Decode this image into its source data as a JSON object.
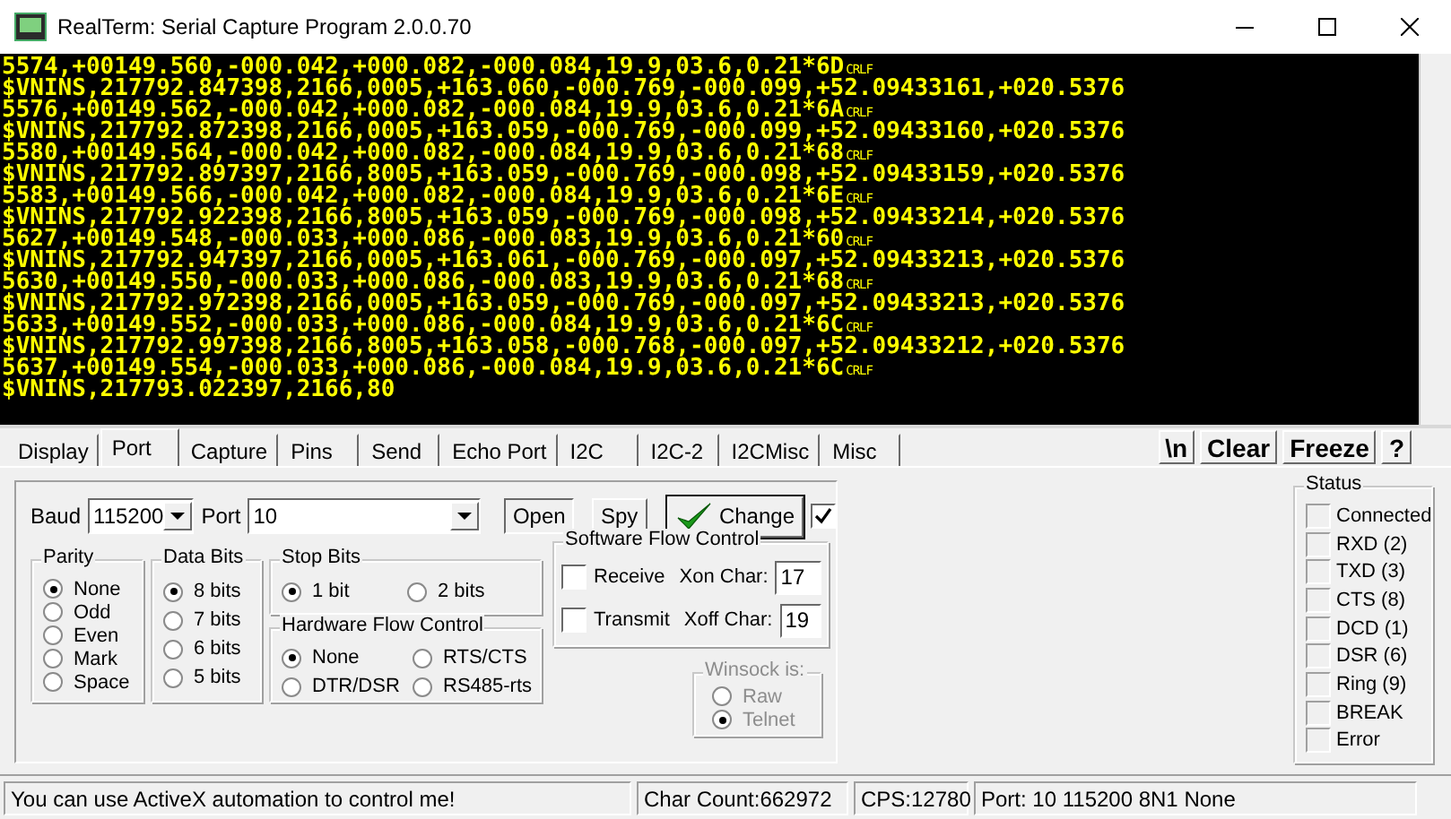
{
  "window": {
    "title": "RealTerm: Serial Capture Program 2.0.0.70"
  },
  "terminal": {
    "lines": [
      {
        "text": "5574,+00149.560,-000.042,+000.082,-000.084,19.9,03.6,0.21*6D",
        "eol": "CRLF"
      },
      {
        "text": "$VNINS,217792.847398,2166,0005,+163.060,-000.769,-000.099,+52.09433161,+020.5376"
      },
      {
        "text": "5576,+00149.562,-000.042,+000.082,-000.084,19.9,03.6,0.21*6A",
        "eol": "CRLF"
      },
      {
        "text": "$VNINS,217792.872398,2166,0005,+163.059,-000.769,-000.099,+52.09433160,+020.5376"
      },
      {
        "text": "5580,+00149.564,-000.042,+000.082,-000.084,19.9,03.6,0.21*68",
        "eol": "CRLF"
      },
      {
        "text": "$VNINS,217792.897397,2166,8005,+163.059,-000.769,-000.098,+52.09433159,+020.5376"
      },
      {
        "text": "5583,+00149.566,-000.042,+000.082,-000.084,19.9,03.6,0.21*6E",
        "eol": "CRLF"
      },
      {
        "text": "$VNINS,217792.922398,2166,8005,+163.059,-000.769,-000.098,+52.09433214,+020.5376"
      },
      {
        "text": "5627,+00149.548,-000.033,+000.086,-000.083,19.9,03.6,0.21*60",
        "eol": "CRLF"
      },
      {
        "text": "$VNINS,217792.947397,2166,0005,+163.061,-000.769,-000.097,+52.09433213,+020.5376"
      },
      {
        "text": "5630,+00149.550,-000.033,+000.086,-000.083,19.9,03.6,0.21*68",
        "eol": "CRLF"
      },
      {
        "text": "$VNINS,217792.972398,2166,0005,+163.059,-000.769,-000.097,+52.09433213,+020.5376"
      },
      {
        "text": "5633,+00149.552,-000.033,+000.086,-000.084,19.9,03.6,0.21*6C",
        "eol": "CRLF"
      },
      {
        "text": "$VNINS,217792.997398,2166,8005,+163.058,-000.768,-000.097,+52.09433212,+020.5376"
      },
      {
        "text": "5637,+00149.554,-000.033,+000.086,-000.084,19.9,03.6,0.21*6C",
        "eol": "CRLF"
      },
      {
        "text": "$VNINS,217793.022397,2166,80"
      }
    ]
  },
  "tabs": [
    {
      "label": "Display",
      "selected": false
    },
    {
      "label": "Port",
      "selected": true
    },
    {
      "label": "Capture",
      "selected": false
    },
    {
      "label": "Pins",
      "selected": false
    },
    {
      "label": "Send",
      "selected": false
    },
    {
      "label": "Echo Port",
      "selected": false
    },
    {
      "label": "I2C",
      "selected": false
    },
    {
      "label": "I2C-2",
      "selected": false
    },
    {
      "label": "I2CMisc",
      "selected": false
    },
    {
      "label": "Misc",
      "selected": false
    }
  ],
  "toolbar_buttons": [
    {
      "label": "\\n"
    },
    {
      "label": "Clear"
    },
    {
      "label": "Freeze"
    },
    {
      "label": "?"
    }
  ],
  "port": {
    "baud": {
      "label": "Baud",
      "value": "115200"
    },
    "port": {
      "label": "Port",
      "value": "10"
    },
    "open_button": {
      "label": "Open",
      "pressed": true
    },
    "spy_button": {
      "label": "Spy",
      "pressed": false
    },
    "change_button": {
      "label": "Change"
    },
    "auto_checkbox": {
      "checked": true
    },
    "parity": {
      "title": "Parity",
      "options": [
        {
          "label": "None",
          "selected": true
        },
        {
          "label": "Odd",
          "selected": false
        },
        {
          "label": "Even",
          "selected": false
        },
        {
          "label": "Mark",
          "selected": false
        },
        {
          "label": "Space",
          "selected": false
        }
      ]
    },
    "data_bits": {
      "title": "Data Bits",
      "options": [
        {
          "label": "8 bits",
          "selected": true
        },
        {
          "label": "7 bits",
          "selected": false
        },
        {
          "label": "6 bits",
          "selected": false
        },
        {
          "label": "5 bits",
          "selected": false
        }
      ]
    },
    "stop_bits": {
      "title": "Stop Bits",
      "options": [
        {
          "label": "1 bit",
          "selected": true
        },
        {
          "label": "2 bits",
          "selected": false
        }
      ]
    },
    "hardware_flow": {
      "title": "Hardware Flow Control",
      "options": [
        {
          "label": "None",
          "selected": true
        },
        {
          "label": "RTS/CTS",
          "selected": false
        },
        {
          "label": "DTR/DSR",
          "selected": false
        },
        {
          "label": "RS485-rts",
          "selected": false
        }
      ]
    },
    "software_flow": {
      "title": "Software Flow Control",
      "rows": [
        {
          "label": "Receive",
          "checked": false,
          "char_label": "Xon Char:",
          "char_value": "17"
        },
        {
          "label": "Transmit",
          "checked": false,
          "char_label": "Xoff Char:",
          "char_value": "19"
        }
      ]
    },
    "winsock": {
      "title": "Winsock is:",
      "disabled": true,
      "options": [
        {
          "label": "Raw",
          "selected": false
        },
        {
          "label": "Telnet",
          "selected": true
        }
      ]
    }
  },
  "status": {
    "title": "Status",
    "indicators": [
      {
        "label": "Connected",
        "on": false
      },
      {
        "label": "RXD (2)",
        "on": false
      },
      {
        "label": "TXD (3)",
        "on": false
      },
      {
        "label": "CTS (8)",
        "on": false
      },
      {
        "label": "DCD (1)",
        "on": false
      },
      {
        "label": "DSR (6)",
        "on": false
      },
      {
        "label": "Ring (9)",
        "on": false
      },
      {
        "label": "BREAK",
        "on": false
      },
      {
        "label": "Error",
        "on": false
      }
    ]
  },
  "status_bar": [
    "You can use ActiveX automation to control me!",
    "Char Count:662972",
    "CPS:12780",
    "Port: 10 115200 8N1 None"
  ]
}
